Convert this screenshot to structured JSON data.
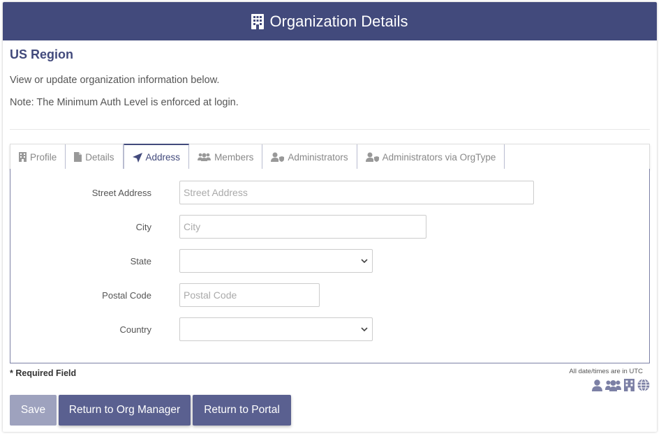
{
  "header": {
    "title": "Organization Details",
    "icon": "building-icon"
  },
  "region": "US Region",
  "intro": "View or update organization information below.",
  "note": "Note: The Minimum Auth Level is enforced at login.",
  "tabs": [
    {
      "label": "Profile",
      "icon": "building-icon"
    },
    {
      "label": "Details",
      "icon": "file-icon"
    },
    {
      "label": "Address",
      "icon": "location-arrow-icon",
      "active": true
    },
    {
      "label": "Members",
      "icon": "users-icon"
    },
    {
      "label": "Administrators",
      "icon": "user-shield-icon"
    },
    {
      "label": "Administrators via OrgType",
      "icon": "user-shield-icon"
    }
  ],
  "form": {
    "street": {
      "label": "Street Address",
      "placeholder": "Street Address",
      "value": ""
    },
    "city": {
      "label": "City",
      "placeholder": "City",
      "value": ""
    },
    "state": {
      "label": "State",
      "value": ""
    },
    "postal": {
      "label": "Postal Code",
      "placeholder": "Postal Code",
      "value": ""
    },
    "country": {
      "label": "Country",
      "value": ""
    }
  },
  "required_note": "* Required Field",
  "utc_note": "All date/times are in UTC",
  "legend_icons": [
    "user-icon",
    "users-icon",
    "building-icon",
    "globe-icon"
  ],
  "buttons": {
    "save": "Save",
    "return_org": "Return to Org Manager",
    "return_portal": "Return to Portal"
  },
  "colors": {
    "primary": "#424a7c",
    "button": "#5a6090",
    "button_disabled": "#9ea2be"
  }
}
